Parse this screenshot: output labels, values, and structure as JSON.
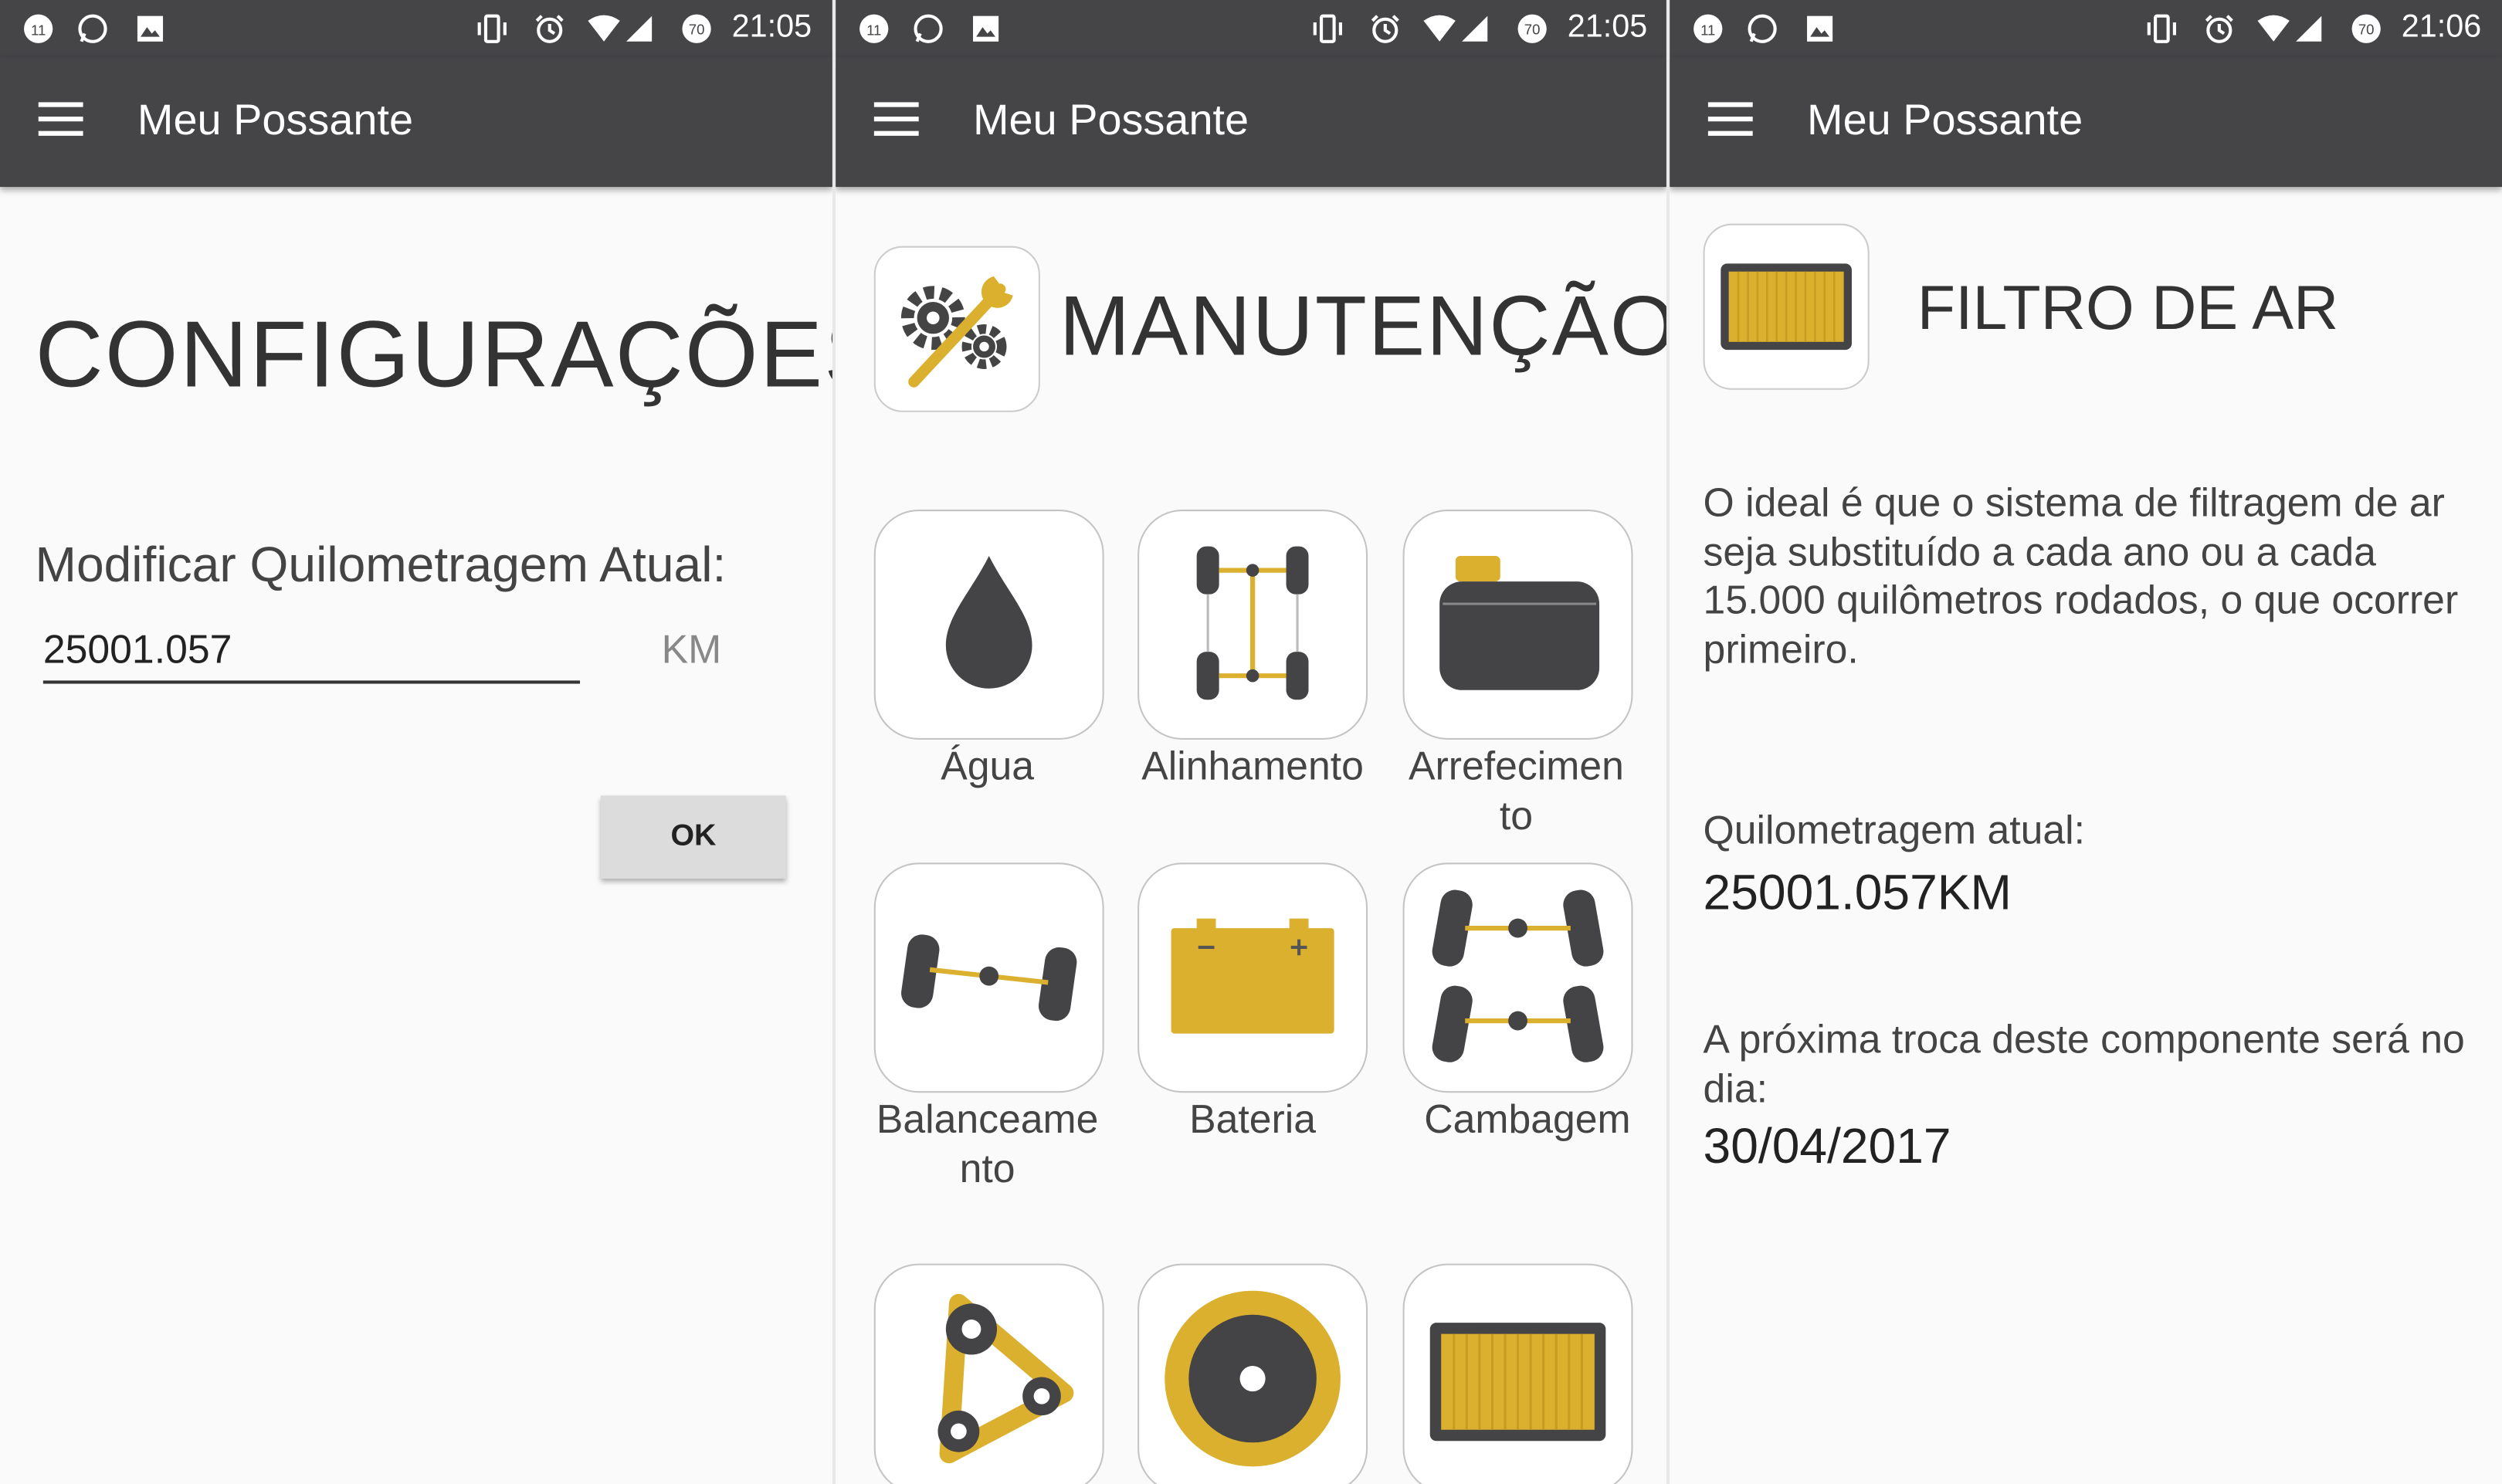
{
  "colors": {
    "bar": "#454548",
    "accent": "#dbb02e",
    "dark": "#444447",
    "background": "#fafafa"
  },
  "screens": [
    {
      "status": {
        "time": "21:05",
        "notification_count": "11",
        "battery": "70"
      },
      "app_title": "Meu Possante",
      "heading": "CONFIGURAÇÕES",
      "mileage_label": "Modificar Quilometragem Atual:",
      "mileage_value": "25001.057",
      "unit": "KM",
      "ok_button": "OK"
    },
    {
      "status": {
        "time": "21:05",
        "notification_count": "11",
        "battery": "70"
      },
      "app_title": "Meu Possante",
      "heading": "MANUTENÇÃO",
      "header_icon": "gears-wrench-icon",
      "items": [
        {
          "label": "Água",
          "icon": "water-drop-icon"
        },
        {
          "label": "Alinhamento",
          "icon": "alignment-icon"
        },
        {
          "label": "Arrefecimen\nto",
          "icon": "coolant-reservoir-icon"
        },
        {
          "label": "Balanceame\nnto",
          "icon": "wheel-balancing-icon"
        },
        {
          "label": "Bateria",
          "icon": "battery-icon"
        },
        {
          "label": "Cambagem",
          "icon": "camber-icon"
        },
        {
          "label": "",
          "icon": "timing-belt-icon"
        },
        {
          "label": "",
          "icon": "brake-disc-icon"
        },
        {
          "label": "",
          "icon": "air-filter-icon"
        }
      ]
    },
    {
      "status": {
        "time": "21:06",
        "notification_count": "11",
        "battery": "70"
      },
      "app_title": "Meu Possante",
      "heading": "FILTRO DE AR",
      "header_icon": "air-filter-icon",
      "description": "O ideal é que o sistema de filtragem de ar seja substituído a cada ano ou a cada 15.000 quilômetros rodados, o que ocorrer primeiro.",
      "mileage_label": "Quilometragem atual:",
      "mileage_value": "25001.057KM",
      "next_change_label": "A próxima troca deste componente será no dia:",
      "next_change_date": "30/04/2017"
    }
  ]
}
